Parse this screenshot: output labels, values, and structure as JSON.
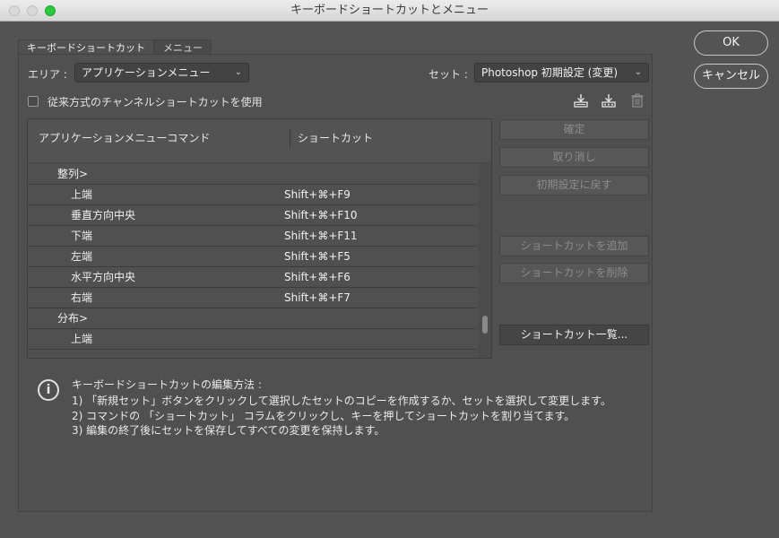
{
  "window": {
    "title": "キーボードショートカットとメニュー"
  },
  "tabs": [
    {
      "label": "キーボードショートカット",
      "active": true
    },
    {
      "label": "メニュー",
      "active": false
    }
  ],
  "area": {
    "label": "エリア :",
    "value": "アプリケーションメニュー"
  },
  "set": {
    "label": "セット :",
    "value": "Photoshop 初期設定 (変更)"
  },
  "legacy_checkbox": {
    "label": "従来方式のチャンネルショートカットを使用",
    "checked": false
  },
  "set_icons": [
    "save-set-icon",
    "new-set-icon",
    "delete-set-icon"
  ],
  "table": {
    "columns": [
      "アプリケーションメニューコマンド",
      "ショートカット"
    ],
    "rows": [
      {
        "command": "整列>",
        "shortcut": "",
        "group": true
      },
      {
        "command": "上端",
        "shortcut": "Shift+⌘+F9",
        "group": false
      },
      {
        "command": "垂直方向中央",
        "shortcut": "Shift+⌘+F10",
        "group": false
      },
      {
        "command": "下端",
        "shortcut": "Shift+⌘+F11",
        "group": false
      },
      {
        "command": "左端",
        "shortcut": "Shift+⌘+F5",
        "group": false
      },
      {
        "command": "水平方向中央",
        "shortcut": "Shift+⌘+F6",
        "group": false
      },
      {
        "command": "右端",
        "shortcut": "Shift+⌘+F7",
        "group": false
      },
      {
        "command": "分布>",
        "shortcut": "",
        "group": true
      },
      {
        "command": "上端",
        "shortcut": "",
        "group": false
      }
    ]
  },
  "side_buttons": {
    "accept": "確定",
    "undo": "取り消し",
    "use_default": "初期設定に戻す",
    "add_shortcut": "ショートカットを追加",
    "delete_shortcut": "ショートカットを削除",
    "summarize": "ショートカット一覧..."
  },
  "dialog_buttons": {
    "ok": "OK",
    "cancel": "キャンセル"
  },
  "info": {
    "heading": "キーボードショートカットの編集方法 :",
    "lines": [
      "1) 「新規セット」ボタンをクリックして選択したセットのコピーを作成するか、セットを選択して変更します。",
      "2) コマンドの 「ショートカット」 コラムをクリックし、キーを押してショートカットを割り当てます。",
      "3) 編集の終了後にセットを保存してすべての変更を保持します。"
    ]
  },
  "colors": {
    "background": "#535353",
    "titlebar": "#dcdcdc",
    "max_button": "#2bc840"
  }
}
